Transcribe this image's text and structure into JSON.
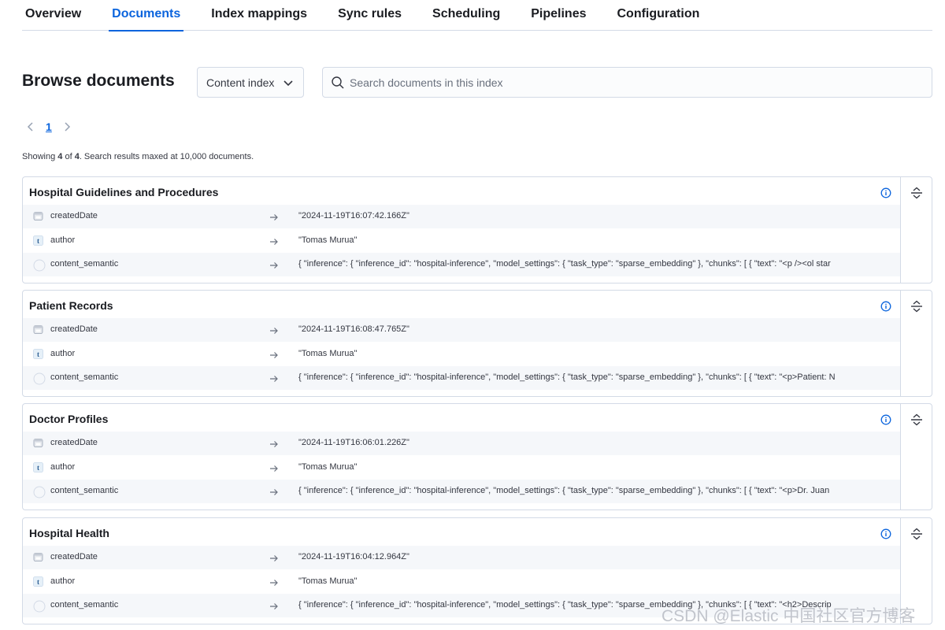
{
  "tabs": [
    {
      "label": "Overview"
    },
    {
      "label": "Documents",
      "active": true
    },
    {
      "label": "Index mappings"
    },
    {
      "label": "Sync rules"
    },
    {
      "label": "Scheduling"
    },
    {
      "label": "Pipelines"
    },
    {
      "label": "Configuration"
    }
  ],
  "header": {
    "title": "Browse documents",
    "index_select": "Content index",
    "search_placeholder": "Search documents in this index"
  },
  "pagination": {
    "current_page": "1"
  },
  "showing": {
    "prefix": "Showing ",
    "count": "4",
    "middle": " of ",
    "total": "4",
    "suffix": ". Search results maxed at 10,000 documents."
  },
  "documents": [
    {
      "title": "Hospital Guidelines and Procedures",
      "fields": [
        {
          "name": "createdDate",
          "type_icon": "date-icon",
          "value": "\"2024-11-19T16:07:42.166Z\""
        },
        {
          "name": "author",
          "type_icon": "text-icon",
          "value": "\"Tomas Murua\""
        },
        {
          "name": "content_semantic",
          "type_icon": "object-icon",
          "value": "{ \"inference\": { \"inference_id\": \"hospital-inference\", \"model_settings\": { \"task_type\": \"sparse_embedding\" }, \"chunks\": [ { \"text\": \"<p /><ol star"
        }
      ]
    },
    {
      "title": "Patient Records",
      "fields": [
        {
          "name": "createdDate",
          "type_icon": "date-icon",
          "value": "\"2024-11-19T16:08:47.765Z\""
        },
        {
          "name": "author",
          "type_icon": "text-icon",
          "value": "\"Tomas Murua\""
        },
        {
          "name": "content_semantic",
          "type_icon": "object-icon",
          "value": "{ \"inference\": { \"inference_id\": \"hospital-inference\", \"model_settings\": { \"task_type\": \"sparse_embedding\" }, \"chunks\": [ { \"text\": \"<p>Patient: N"
        }
      ]
    },
    {
      "title": "Doctor Profiles",
      "fields": [
        {
          "name": "createdDate",
          "type_icon": "date-icon",
          "value": "\"2024-11-19T16:06:01.226Z\""
        },
        {
          "name": "author",
          "type_icon": "text-icon",
          "value": "\"Tomas Murua\""
        },
        {
          "name": "content_semantic",
          "type_icon": "object-icon",
          "value": "{ \"inference\": { \"inference_id\": \"hospital-inference\", \"model_settings\": { \"task_type\": \"sparse_embedding\" }, \"chunks\": [ { \"text\": \"<p>Dr. Juan"
        }
      ]
    },
    {
      "title": "Hospital Health",
      "fields": [
        {
          "name": "createdDate",
          "type_icon": "date-icon",
          "value": "\"2024-11-19T16:04:12.964Z\""
        },
        {
          "name": "author",
          "type_icon": "text-icon",
          "value": "\"Tomas Murua\""
        },
        {
          "name": "content_semantic",
          "type_icon": "object-icon",
          "value": "{ \"inference\": { \"inference_id\": \"hospital-inference\", \"model_settings\": { \"task_type\": \"sparse_embedding\" }, \"chunks\": [ { \"text\": \"<h2>Descrip"
        }
      ]
    }
  ],
  "watermark": "CSDN @Elastic 中国社区官方博客",
  "colors": {
    "accent": "#0b64dd",
    "border": "#d3dae6",
    "row_shade": "#f5f7fa",
    "text": "#343741"
  }
}
